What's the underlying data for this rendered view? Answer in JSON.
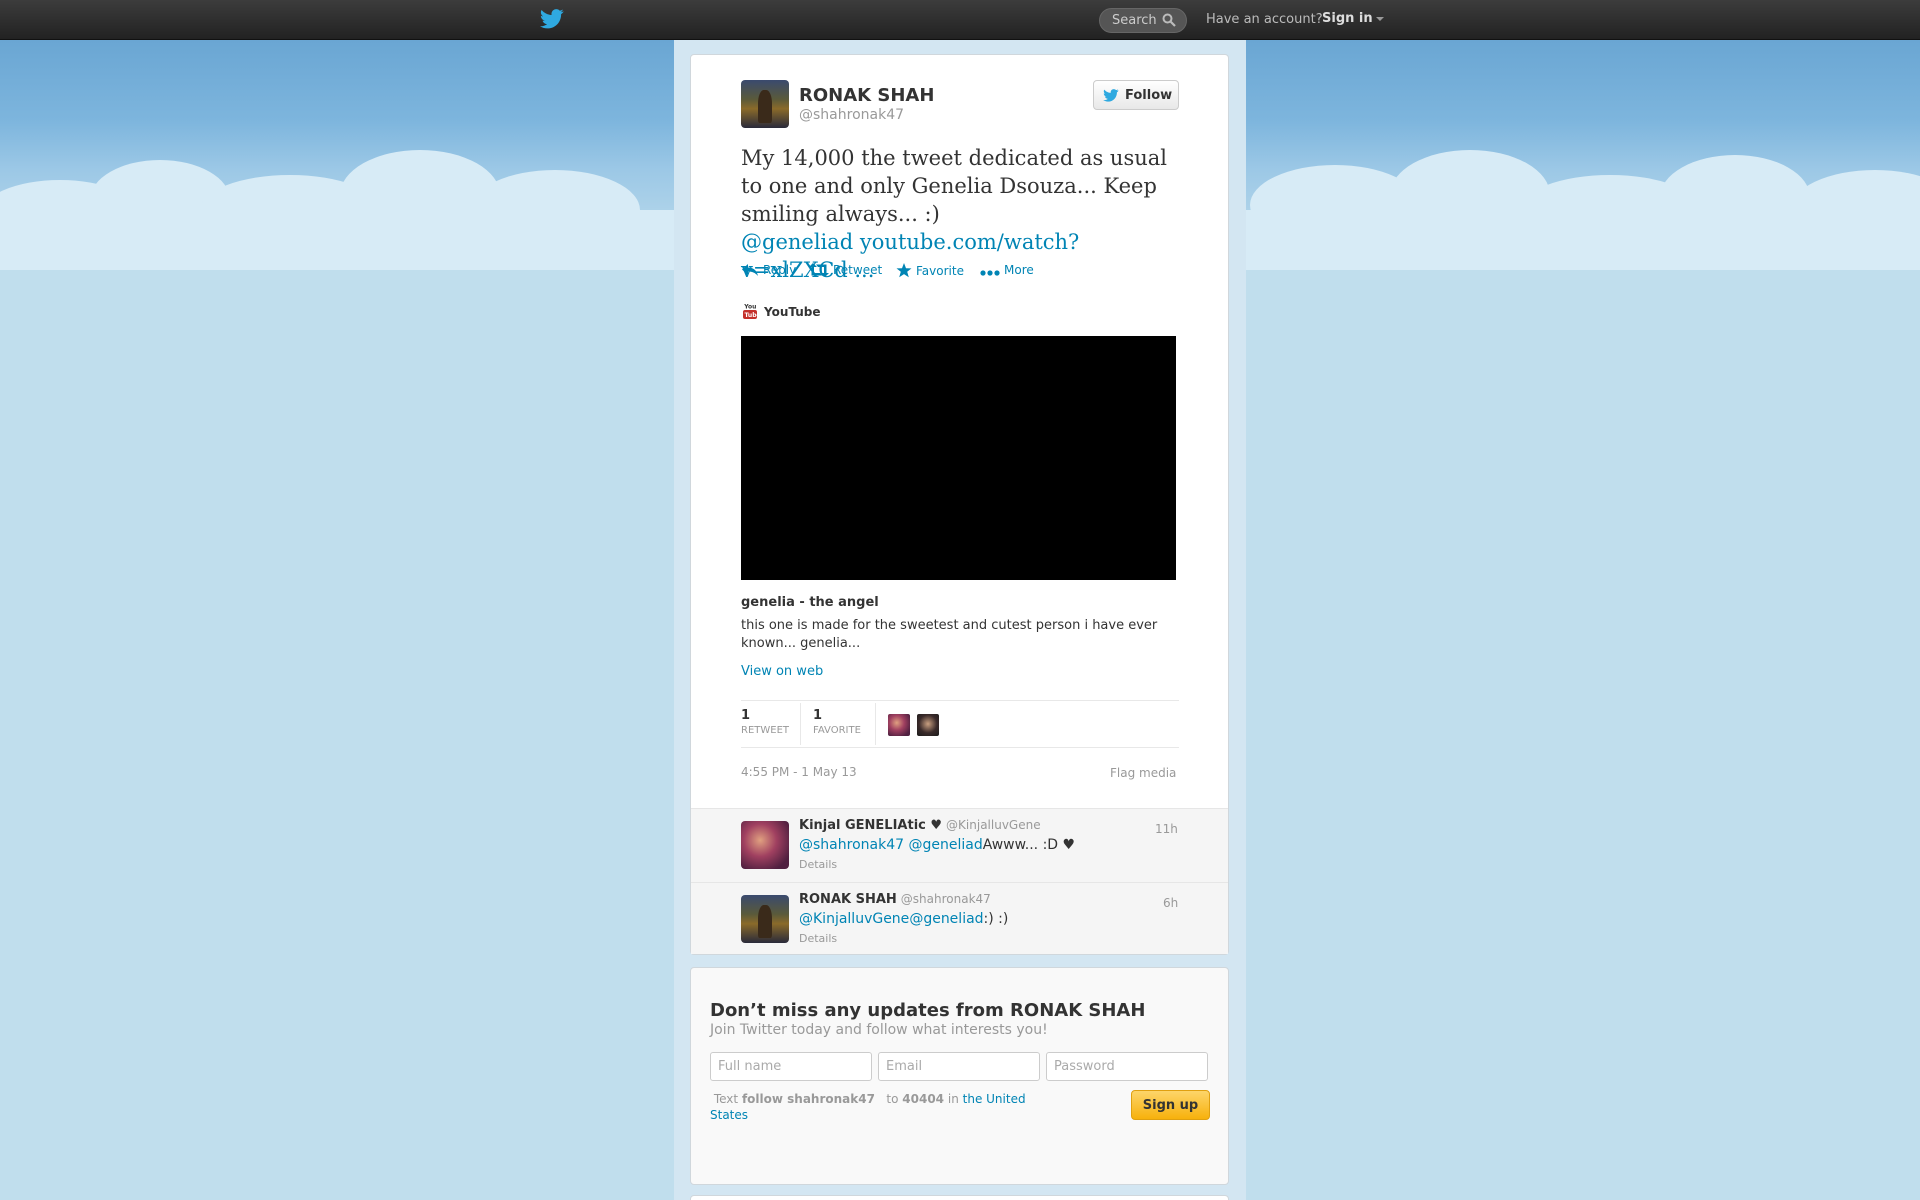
{
  "topbar": {
    "search_placeholder": "Search",
    "have_account": "Have an account?",
    "sign_in": "Sign in"
  },
  "tweet": {
    "author_name": "RONAK SHAH",
    "author_handle": "@shahronak47",
    "follow_label": "Follow",
    "text": "My 14,000 the tweet dedicated as usual to one and only Genelia Dsouza... Keep smiling always... :) ",
    "mention": "@geneliad",
    "link": "youtube.com/watch?v=xlZXCd ...",
    "actions": {
      "reply": "Reply",
      "retweet": "Retweet",
      "favorite": "Favorite",
      "more": "More"
    },
    "media_source": "YouTube",
    "video_title": "genelia - the angel",
    "video_description": "this one is made for the sweetest and cutest person i have ever known... genelia...",
    "view_on_web": "View on web",
    "stats": {
      "retweets_count": "1",
      "retweets_label": "RETWEET",
      "favorites_count": "1",
      "favorites_label": "FAVORITE"
    },
    "timestamp": "4:55 PM - 1 May 13",
    "flag_media": "Flag media"
  },
  "replies": [
    {
      "name": "Kinjal GENELIAtic ♥",
      "handle": "@KinjalluvGene",
      "time": "11h",
      "mention1": "@shahronak47",
      "mention2": "@geneliad",
      "text": "Awww... :D ♥",
      "details": "Details"
    },
    {
      "name": "RONAK SHAH",
      "handle": "@shahronak47",
      "time": "6h",
      "mention1": "@KinjalluvGene",
      "mention2": "@geneliad",
      "text": ":) :)",
      "details": "Details"
    }
  ],
  "signup": {
    "title": "Don’t miss any updates from RONAK SHAH",
    "subtitle": "Join Twitter today and follow what interests you!",
    "fullname_placeholder": "Full name",
    "email_placeholder": "Email",
    "password_placeholder": "Password",
    "note_text": "Text",
    "note_command": "follow shahronak47",
    "note_to": "to",
    "note_number": "40404",
    "note_in": "in",
    "note_country": "the United States",
    "button": "Sign up"
  },
  "colors": {
    "link": "#0084b4",
    "background": "#c0deed",
    "signup_button": "#f7b10c"
  }
}
